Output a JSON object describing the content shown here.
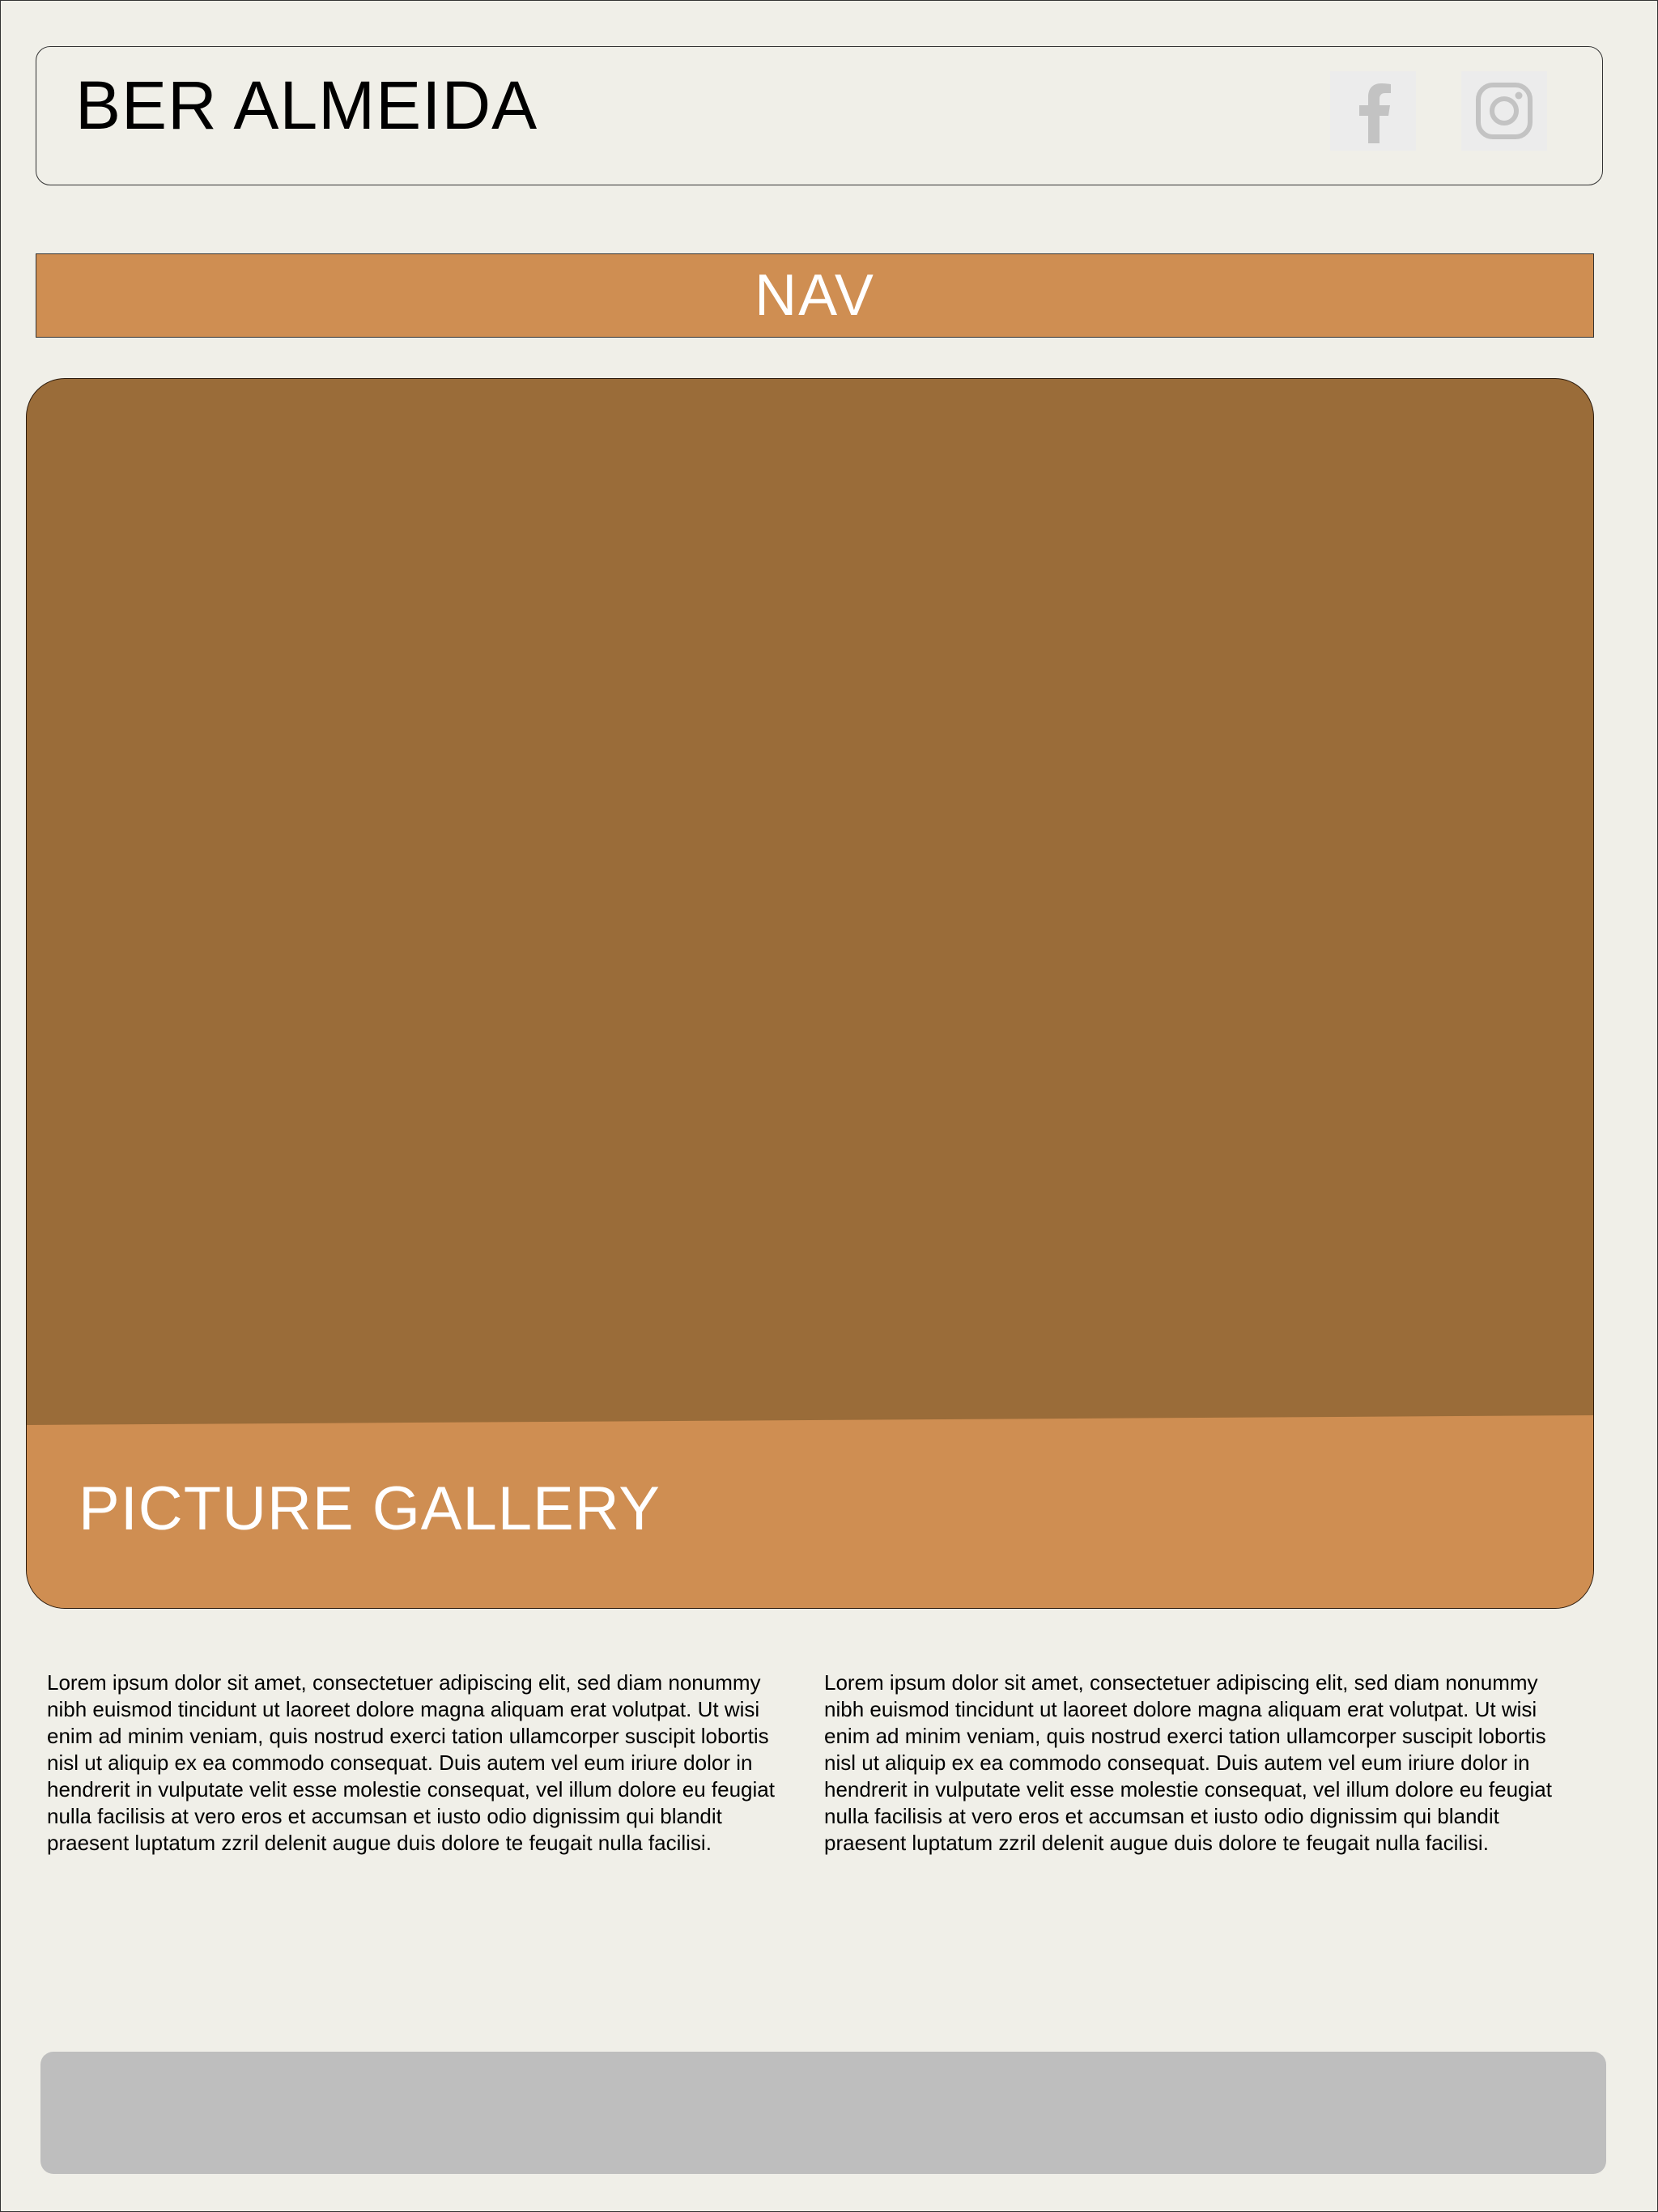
{
  "header": {
    "title": "BER ALMEIDA",
    "social": [
      {
        "icon": "facebook-icon"
      },
      {
        "icon": "instagram-icon"
      }
    ]
  },
  "nav": {
    "label": "NAV"
  },
  "hero": {
    "title": "PICTURE GALLERY"
  },
  "content": {
    "columns": [
      "Lorem ipsum dolor sit amet, consectetuer adipiscing elit, sed diam nonummy nibh euismod tincidunt ut laoreet dolore magna aliquam erat volutpat. Ut wisi enim ad minim veniam, quis nostrud exerci tation ullamcorper suscipit lobortis nisl ut aliquip ex ea commodo consequat. Duis autem vel eum iriure dolor in hendrerit in vulputate velit esse molestie consequat, vel illum dolore eu feugiat nulla facilisis at vero eros et accumsan et iusto odio dignissim qui blandit praesent luptatum zzril delenit augue duis dolore te feugait nulla facilisi.",
      "Lorem ipsum dolor sit amet, consectetuer adipiscing elit, sed diam nonummy nibh euismod tincidunt ut laoreet dolore magna aliquam erat volutpat. Ut wisi enim ad minim veniam, quis nostrud exerci tation ullamcorper suscipit lobortis nisl ut aliquip ex ea commodo consequat. Duis autem vel eum iriure dolor in hendrerit in vulputate velit esse molestie consequat, vel illum dolore eu feugiat nulla facilisis at vero eros et accumsan et iusto odio dignissim qui blandit praesent luptatum zzril delenit augue duis dolore te feugait nulla facilisi."
    ]
  },
  "colors": {
    "background": "#f0efe8",
    "accent": "#cf8e52",
    "hero": "#9a6c39",
    "footer": "#bebebe",
    "icon": "#c3c3c3"
  }
}
